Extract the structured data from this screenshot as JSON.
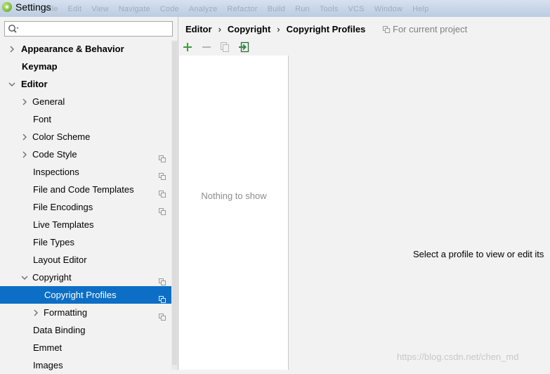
{
  "window": {
    "title": "Settings",
    "background_menu": [
      "File",
      "Edit",
      "View",
      "Navigate",
      "Code",
      "Analyze",
      "Refactor",
      "Build",
      "Run",
      "Tools",
      "VCS",
      "Window",
      "Help"
    ]
  },
  "search": {
    "value": "",
    "placeholder": ""
  },
  "tree": [
    {
      "label": "Appearance & Behavior",
      "bold": true,
      "arrow": "collapsed",
      "indent": 0,
      "project_icon": false,
      "selected": false
    },
    {
      "label": "Keymap",
      "bold": true,
      "arrow": "none",
      "indent": 0,
      "project_icon": false,
      "selected": false
    },
    {
      "label": "Editor",
      "bold": true,
      "arrow": "expanded",
      "indent": 0,
      "project_icon": false,
      "selected": false
    },
    {
      "label": "General",
      "bold": false,
      "arrow": "collapsed",
      "indent": 1,
      "project_icon": false,
      "selected": false
    },
    {
      "label": "Font",
      "bold": false,
      "arrow": "none",
      "indent": 1,
      "project_icon": false,
      "selected": false
    },
    {
      "label": "Color Scheme",
      "bold": false,
      "arrow": "collapsed",
      "indent": 1,
      "project_icon": false,
      "selected": false
    },
    {
      "label": "Code Style",
      "bold": false,
      "arrow": "collapsed",
      "indent": 1,
      "project_icon": true,
      "selected": false
    },
    {
      "label": "Inspections",
      "bold": false,
      "arrow": "none",
      "indent": 1,
      "project_icon": true,
      "selected": false
    },
    {
      "label": "File and Code Templates",
      "bold": false,
      "arrow": "none",
      "indent": 1,
      "project_icon": true,
      "selected": false
    },
    {
      "label": "File Encodings",
      "bold": false,
      "arrow": "none",
      "indent": 1,
      "project_icon": true,
      "selected": false
    },
    {
      "label": "Live Templates",
      "bold": false,
      "arrow": "none",
      "indent": 1,
      "project_icon": false,
      "selected": false
    },
    {
      "label": "File Types",
      "bold": false,
      "arrow": "none",
      "indent": 1,
      "project_icon": false,
      "selected": false
    },
    {
      "label": "Layout Editor",
      "bold": false,
      "arrow": "none",
      "indent": 1,
      "project_icon": false,
      "selected": false
    },
    {
      "label": "Copyright",
      "bold": false,
      "arrow": "expanded",
      "indent": 1,
      "project_icon": true,
      "selected": false
    },
    {
      "label": "Copyright Profiles",
      "bold": false,
      "arrow": "none",
      "indent": 2,
      "project_icon": true,
      "selected": true
    },
    {
      "label": "Formatting",
      "bold": false,
      "arrow": "collapsed",
      "indent": 2,
      "project_icon": true,
      "selected": false
    },
    {
      "label": "Data Binding",
      "bold": false,
      "arrow": "none",
      "indent": 1,
      "project_icon": false,
      "selected": false
    },
    {
      "label": "Emmet",
      "bold": false,
      "arrow": "none",
      "indent": 1,
      "project_icon": false,
      "selected": false
    },
    {
      "label": "Images",
      "bold": false,
      "arrow": "none",
      "indent": 1,
      "project_icon": false,
      "selected": false
    }
  ],
  "breadcrumb": [
    "Editor",
    "Copyright",
    "Copyright Profiles"
  ],
  "breadcrumb_separator": "›",
  "for_current_project": "For current project",
  "profiles": {
    "toolbar": [
      {
        "icon": "add-icon",
        "enabled": true
      },
      {
        "icon": "remove-icon",
        "enabled": false
      },
      {
        "icon": "copy-icon",
        "enabled": false
      },
      {
        "icon": "import-icon",
        "enabled": true
      }
    ],
    "empty_text": "Nothing to show"
  },
  "detail": {
    "message": "Select a profile to view or edit its"
  },
  "watermark": "https://blog.csdn.net/chen_md",
  "colors": {
    "selection": "#0c6fc5",
    "add": "#3c9d3c",
    "import": "#2b8a3e"
  }
}
